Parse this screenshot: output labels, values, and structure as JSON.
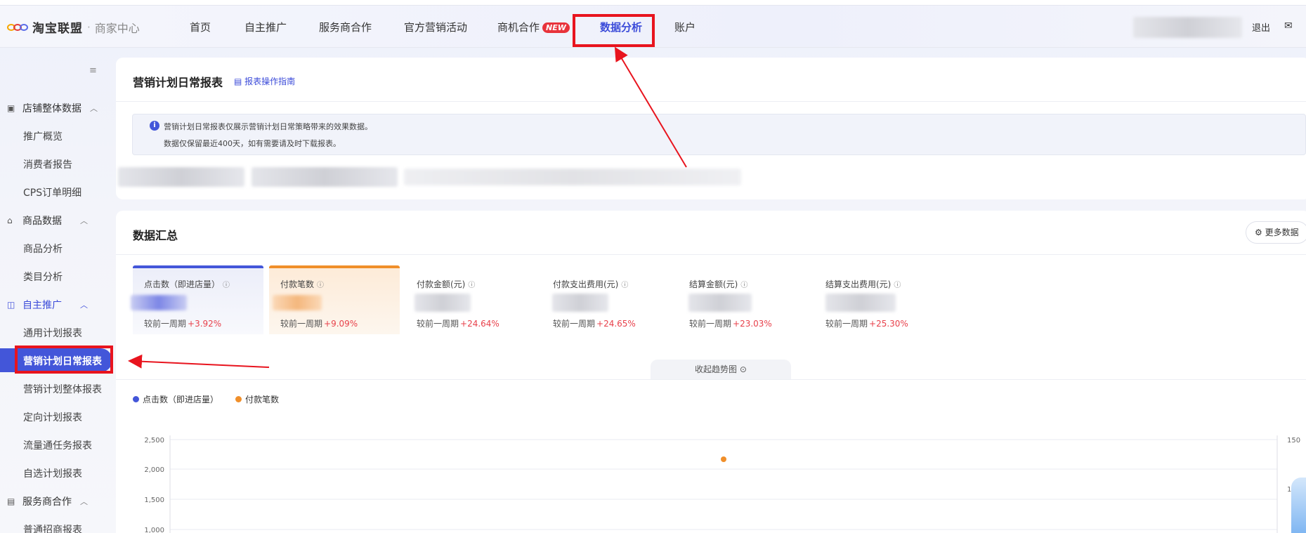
{
  "header": {
    "logo_text": "淘宝联盟",
    "logo_sep": "·",
    "logo_sub": "商家中心",
    "nav": [
      {
        "label": "首页"
      },
      {
        "label": "自主推广"
      },
      {
        "label": "服务商合作"
      },
      {
        "label": "官方营销活动"
      },
      {
        "label": "商机合作",
        "badge": "NEW"
      },
      {
        "label": "数据分析",
        "active": true
      },
      {
        "label": "账户"
      }
    ],
    "logout_label": "退出"
  },
  "sidebar": {
    "groups": [
      {
        "label": "店铺整体数据",
        "icon": "store-data-icon",
        "items": [
          "推广概览",
          "消费者报告",
          "CPS订单明细"
        ]
      },
      {
        "label": "商品数据",
        "icon": "bag-icon",
        "items": [
          "商品分析",
          "类目分析"
        ]
      },
      {
        "label": "自主推广",
        "icon": "promote-icon",
        "items": [
          "通用计划报表",
          "营销计划日常报表",
          "营销计划整体报表",
          "定向计划报表",
          "流量通任务报表",
          "自选计划报表"
        ]
      },
      {
        "label": "服务商合作",
        "icon": "partner-icon",
        "items": [
          "普通招商报表"
        ]
      }
    ],
    "active_item": "营销计划日常报表"
  },
  "report_card": {
    "title": "营销计划日常报表",
    "guide_link": "报表操作指南",
    "notice_lines": [
      "营销计划日常报表仅展示营销计划日常策略带来的效果数据。",
      "数据仅保留最近400天，如有需要请及时下载报表。"
    ]
  },
  "summary_card": {
    "title": "数据汇总",
    "more_button": "更多数据",
    "compare_prefix": "较前一周期",
    "metrics": [
      {
        "label": "点击数（即进店量）",
        "change": "+3.92%"
      },
      {
        "label": "付款笔数",
        "change": "+9.09%"
      },
      {
        "label": "付款金额(元)",
        "change": "+24.64%"
      },
      {
        "label": "付款支出费用(元)",
        "change": "+24.65%"
      },
      {
        "label": "结算金额(元)",
        "change": "+23.03%"
      },
      {
        "label": "结算支出费用(元)",
        "change": "+25.30%"
      }
    ],
    "collapse_label": "收起趋势图"
  },
  "colors": {
    "accent": "#4356d9",
    "orange": "#f08f2a",
    "highlight": "#e8141e",
    "up": "#e8414b"
  },
  "chart_data": {
    "type": "line",
    "series": [
      {
        "name": "点击数（即进店量）",
        "color": "#4356d9",
        "values": []
      },
      {
        "name": "付款笔数",
        "color": "#f08f2a",
        "values": [
          130
        ]
      }
    ],
    "y_left_ticks": [
      "2,500",
      "2,000",
      "1,500",
      "1,000"
    ],
    "y_right_ticks": [
      "150",
      "100"
    ],
    "grid": true,
    "legend": "top-left"
  }
}
